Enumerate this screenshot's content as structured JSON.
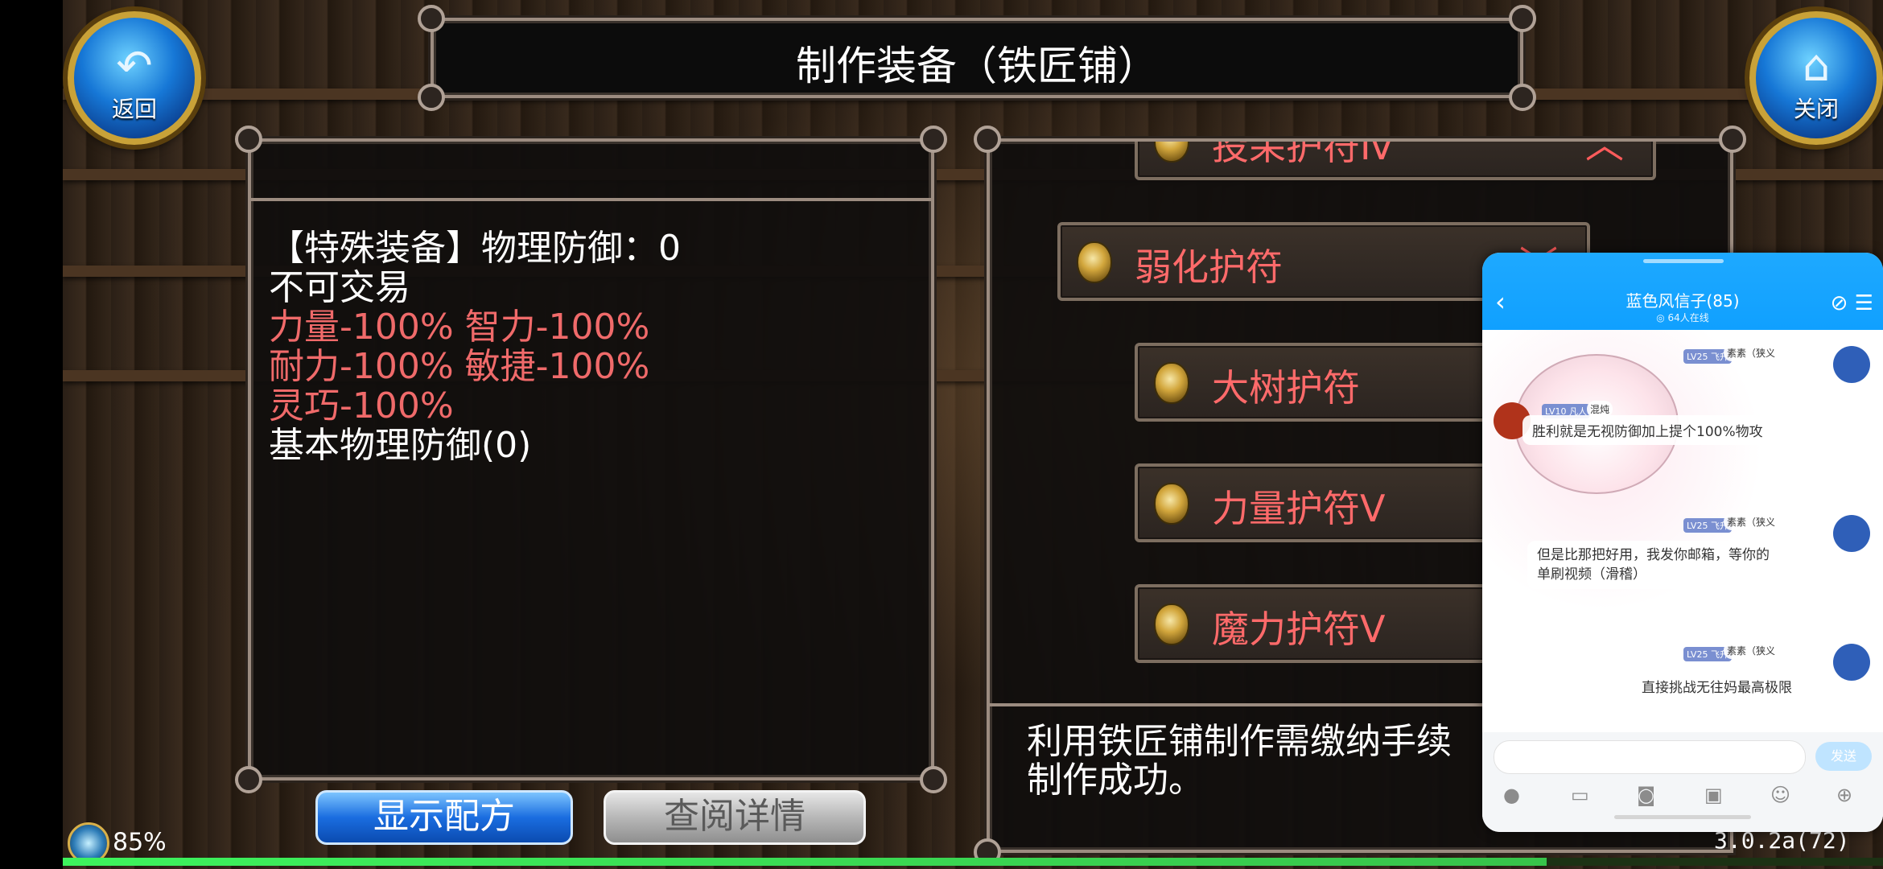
{
  "window_title": "制作装备（铁匠铺）",
  "nav": {
    "back_label": "返回",
    "close_label": "关闭"
  },
  "item_info": {
    "lines": [
      {
        "text": "【特殊装备】物理防御：0",
        "color": "#ffffff"
      },
      {
        "text": "不可交易",
        "color": "#ffffff"
      },
      {
        "text": "力量-100% 智力-100%",
        "color": "#f06a6a"
      },
      {
        "text": "耐力-100% 敏捷-100%",
        "color": "#f06a6a"
      },
      {
        "text": "灵巧-100%",
        "color": "#f06a6a"
      },
      {
        "text": "基本物理防御(0)",
        "color": "#ffffff"
      }
    ]
  },
  "recipe_list": {
    "items": [
      {
        "label": "投呆护符Ⅳ",
        "icon": "amulet-icon",
        "chevron": "︿"
      },
      {
        "label": "弱化护符",
        "icon": "amulet-icon",
        "chevron": "﹀"
      },
      {
        "label": "大树护符",
        "icon": "amulet-icon"
      },
      {
        "label": "力量护符Ⅴ",
        "icon": "amulet-icon"
      },
      {
        "label": "魔力护符Ⅴ",
        "icon": "amulet-icon"
      }
    ]
  },
  "description": {
    "line1": "利用铁匠铺制作需缴纳手续",
    "line2": "制作成功。"
  },
  "buttons": {
    "show_recipe": "显示配方",
    "view_details": "查阅详情"
  },
  "status": {
    "battery": "85%",
    "version": "3.0.2a(72)",
    "progress": 0.815
  },
  "chat": {
    "title": "蓝色风信子(85)",
    "online": "◎ 64人在线",
    "messages": [
      {
        "badge": "LV25 飞升",
        "name": "素素（狭义",
        "text": ""
      },
      {
        "badge": "LV10 凡人",
        "name": "混炖",
        "text": "胜利就是无视防御加上提个100%物攻"
      },
      {
        "badge": "LV25 飞升",
        "name": "素素（狭义",
        "text": "但是比那把好用，我发你邮箱，等你的单刷视频（滑稽）"
      },
      {
        "badge": "LV25 飞升",
        "name": "素素（狭义",
        "text": "直接挑战无往妈最高极限"
      }
    ],
    "send_label": "发送",
    "tools": [
      "mic-icon",
      "image-icon",
      "camera-icon",
      "gift-icon",
      "emoji-icon",
      "plus-icon"
    ]
  },
  "colors": {
    "accent_red": "#ff6a6a",
    "chat_blue": "#10a0ff",
    "progress_green": "#3df35d"
  }
}
